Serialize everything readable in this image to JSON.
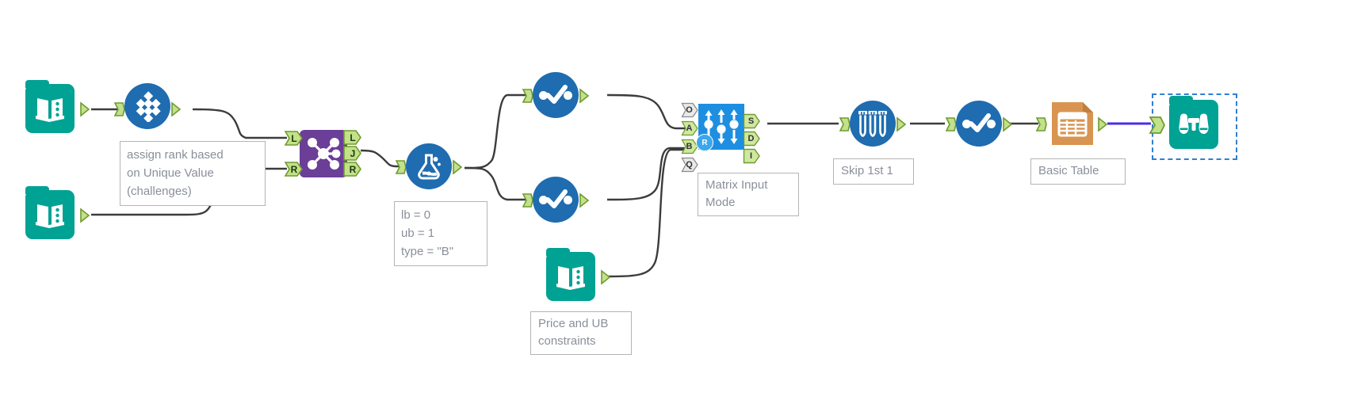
{
  "app": {
    "title": "Alteryx Designer Workflow Canvas",
    "canvas_background": "#ffffff"
  },
  "colors": {
    "teal": "#00a294",
    "blue_circle": "#1f6cb0",
    "purple": "#6b3e97",
    "bright_blue": "#1e8fe0",
    "orange": "#d99452",
    "anchor_green": "#c3e08a",
    "anchor_green_stroke": "#6f9b2f",
    "wire": "#3c3c3c",
    "wire_selected": "#4b2ee8",
    "annotation_text": "#8a8f99",
    "selection_outline": "#2f7fd1"
  },
  "tools": [
    {
      "id": "input-top",
      "name": "input-data-tool",
      "icon": "book-input-icon",
      "type": "input",
      "label": ""
    },
    {
      "id": "unique",
      "name": "unique-tool",
      "icon": "diamond-grid-icon",
      "type": "transform",
      "label": ""
    },
    {
      "id": "input-bottom",
      "name": "input-data-tool",
      "icon": "book-input-icon",
      "type": "input",
      "label": ""
    },
    {
      "id": "join",
      "name": "join-tool",
      "icon": "join-nodes-icon",
      "type": "join",
      "label": ""
    },
    {
      "id": "flask",
      "name": "optimization-model-tool",
      "icon": "flask-icon",
      "type": "model",
      "label": ""
    },
    {
      "id": "select-top",
      "name": "select-tool",
      "icon": "checkmark-circle-icon",
      "type": "select",
      "label": ""
    },
    {
      "id": "select-bottom",
      "name": "select-tool",
      "icon": "checkmark-circle-icon",
      "type": "select",
      "label": ""
    },
    {
      "id": "input-price",
      "name": "input-data-tool",
      "icon": "book-input-icon",
      "type": "input",
      "label": ""
    },
    {
      "id": "optimization",
      "name": "optimization-tool",
      "icon": "sliders-arrows-icon",
      "type": "optimization",
      "label": ""
    },
    {
      "id": "sample",
      "name": "sample-tool",
      "icon": "test-tubes-icon",
      "type": "sample",
      "label": ""
    },
    {
      "id": "select-right",
      "name": "select-tool",
      "icon": "checkmark-circle-icon",
      "type": "select",
      "label": ""
    },
    {
      "id": "basic-table",
      "name": "table-tool",
      "icon": "report-table-icon",
      "type": "report",
      "label": ""
    },
    {
      "id": "browse",
      "name": "browse-tool",
      "icon": "binoculars-icon",
      "type": "browse",
      "label": ""
    }
  ],
  "annotations": {
    "assign_rank": "assign rank based\non Unique Value\n(challenges)",
    "bounds": "lb = 0\nub = 1\ntype = \"B\"",
    "matrix_input_mode": "Matrix Input\nMode",
    "price_and_ub": "Price and UB\nconstraints",
    "skip_first": "Skip 1st 1",
    "basic_table": "Basic Table"
  },
  "ports": {
    "optimization_inputs": [
      {
        "letter": "O",
        "active": false
      },
      {
        "letter": "A",
        "active": true
      },
      {
        "letter": "B",
        "active": true
      },
      {
        "letter": "Q",
        "active": false
      }
    ],
    "optimization_outputs": [
      {
        "letter": "S",
        "active": true
      },
      {
        "letter": "D",
        "active": true
      },
      {
        "letter": "I",
        "active": true
      }
    ],
    "join_inputs": [
      {
        "letter": "L"
      },
      {
        "letter": "R"
      }
    ],
    "join_outputs": [
      {
        "letter": "L"
      },
      {
        "letter": "J"
      },
      {
        "letter": "R"
      }
    ]
  },
  "selection": {
    "selected_tool": "browse-tool"
  }
}
